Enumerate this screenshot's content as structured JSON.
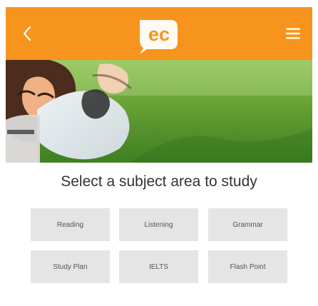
{
  "header": {
    "background_color": "#f7941d",
    "back_icon": "chevron-left-icon",
    "logo_text": "ec",
    "menu_icon": "hamburger-menu-icon"
  },
  "hero": {
    "description_icon": "hero-photo"
  },
  "main": {
    "title": "Select a subject area to study",
    "subjects": [
      {
        "label": "Reading"
      },
      {
        "label": "Listening"
      },
      {
        "label": "Grammar"
      },
      {
        "label": "Study Plan"
      },
      {
        "label": "IELTS"
      },
      {
        "label": "Flash Point"
      }
    ]
  },
  "colors": {
    "accent": "#f7941d",
    "button_bg": "#e5e5e5",
    "title_text": "#333333",
    "button_text": "#555555"
  }
}
